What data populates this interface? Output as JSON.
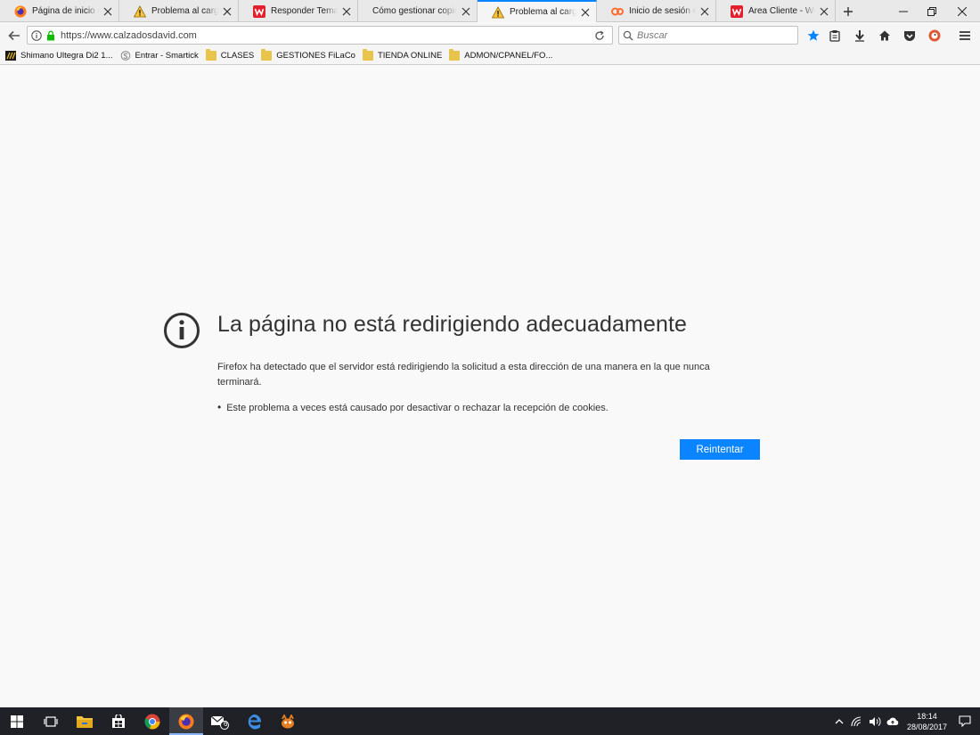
{
  "tabs": [
    {
      "label": "Página de inicio de M",
      "icon": "firefox-icon"
    },
    {
      "label": "Problema al cargar la",
      "icon": "warning-icon"
    },
    {
      "label": "Responder Tema: No",
      "icon": "webempresa-icon"
    },
    {
      "label": "Cómo gestionar copias de",
      "icon": "none"
    },
    {
      "label": "Problema al cargar la",
      "icon": "warning-icon",
      "active": true
    },
    {
      "label": "Inicio de sesión de c",
      "icon": "cpanel-icon"
    },
    {
      "label": "Área Cliente - Webem",
      "icon": "webempresa-icon"
    }
  ],
  "navbar": {
    "url": "https://www.calzadosdavid.com",
    "search_placeholder": "Buscar"
  },
  "bookmarks": [
    {
      "label": "Shimano Ultegra Di2 1...",
      "icon": "bike-icon"
    },
    {
      "label": "Entrar - Smartick",
      "icon": "smartick-icon"
    },
    {
      "label": "CLASES",
      "icon": "folder-icon"
    },
    {
      "label": "GESTIONES FiLaCo",
      "icon": "folder-icon"
    },
    {
      "label": "TIENDA ONLINE",
      "icon": "folder-icon"
    },
    {
      "label": "ADMON/CPANEL/FO...",
      "icon": "folder-icon"
    }
  ],
  "error": {
    "title": "La página no está redirigiendo adecuadamente",
    "description": "Firefox ha detectado que el servidor está redirigiendo la solicitud a esta dirección de una manera en la que nunca terminará.",
    "bullet": "Este problema a veces está causado por desactivar o rechazar la recepción de cookies.",
    "retry_label": "Reintentar"
  },
  "taskbar": {
    "mail_badge": "6",
    "time": "18:14",
    "date": "28/08/2017"
  },
  "colors": {
    "accent": "#0a84ff",
    "taskbar": "#1f2126"
  }
}
